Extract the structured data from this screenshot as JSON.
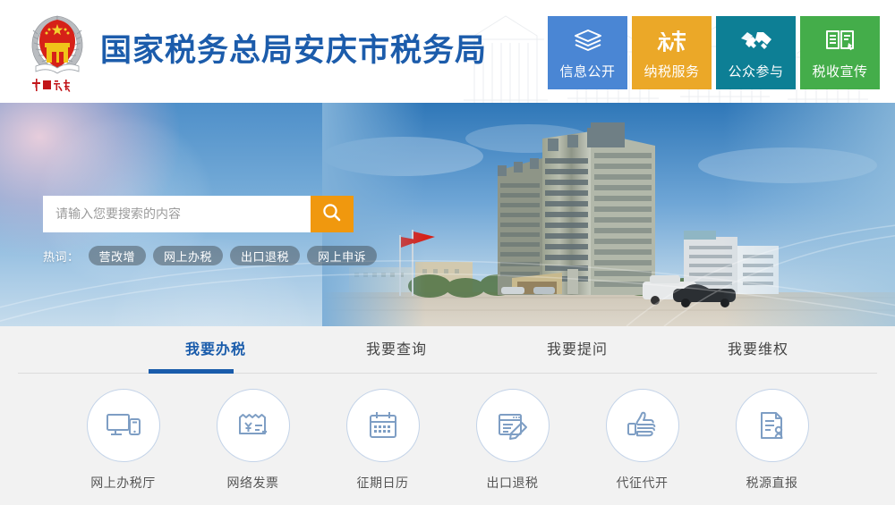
{
  "site": {
    "title": "国家税务总局安庆市税务局",
    "emblem_name": "china-tax-emblem",
    "emblem_caption": "中国税务",
    "title_color": "#1c5cab"
  },
  "nav_tiles": [
    {
      "label": "信息公开",
      "icon": "books-stack-icon",
      "color": "#4a86d4"
    },
    {
      "label": "纳税服务",
      "icon": "tax-character-icon",
      "color": "#eba828"
    },
    {
      "label": "公众参与",
      "icon": "handshake-icon",
      "color": "#0d7f95"
    },
    {
      "label": "税收宣传",
      "icon": "open-book-icon",
      "color": "#44ad4a"
    }
  ],
  "search": {
    "placeholder": "请输入您要搜索的内容",
    "value": "",
    "button_icon": "search-icon",
    "button_color": "#f0980e",
    "hotwords_label": "热词：",
    "hotwords": [
      "营改增",
      "网上办税",
      "出口退税",
      "网上申诉"
    ]
  },
  "services": {
    "tabs": [
      {
        "label": "我要办税",
        "active": true
      },
      {
        "label": "我要查询",
        "active": false
      },
      {
        "label": "我要提问",
        "active": false
      },
      {
        "label": "我要维权",
        "active": false
      }
    ],
    "active_tab_color": "#1a5cab",
    "items": [
      {
        "label": "网上办税厅",
        "icon": "monitor-mobile-icon"
      },
      {
        "label": "网络发票",
        "icon": "invoice-yuan-icon"
      },
      {
        "label": "征期日历",
        "icon": "calendar-icon"
      },
      {
        "label": "出口退税",
        "icon": "form-pencil-icon"
      },
      {
        "label": "代征代开",
        "icon": "thumbs-up-hand-icon"
      },
      {
        "label": "税源直报",
        "icon": "document-stamp-icon"
      }
    ]
  }
}
